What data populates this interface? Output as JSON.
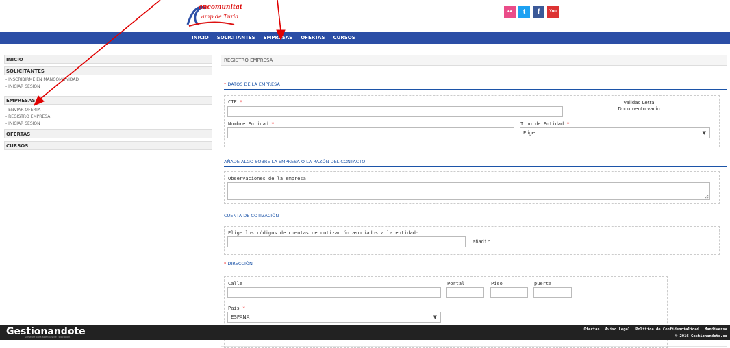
{
  "header": {
    "logo_line1": "ancomunitat",
    "logo_line2": "amp de Túria",
    "social_icons": [
      "flickr-icon",
      "twitter-icon",
      "facebook-icon",
      "youtube-icon"
    ],
    "social_glyphs": [
      "••",
      "t",
      "f",
      "You"
    ],
    "social_colors": [
      "#ea4c89",
      "#1da1f2",
      "#3b5998",
      "#d33"
    ]
  },
  "nav": {
    "items": [
      "INICIO",
      "SOLICITANTES",
      "EMPRESAS",
      "OFERTAS",
      "CURSOS"
    ],
    "bg": "#2b4ea6"
  },
  "sidebar": {
    "inicio": "INICIO",
    "solicitantes": "SOLICITANTES",
    "solicitantes_items": [
      "- INSCRIBIRME EN MANCOMUNIDAD",
      "- INICIAR SESIÓN"
    ],
    "empresas": "EMPRESAS",
    "empresas_items": [
      "- ENVIAR OFERTA",
      "- REGISTRO EMPRESA",
      "- INICIAR SESIÓN"
    ],
    "ofertas": "OFERTAS",
    "cursos": "CURSOS"
  },
  "main": {
    "title": "REGISTRO EMPRESA",
    "sec_datos": "DATOS DE LA EMPRESA",
    "cif_label": "CIF",
    "validac_line1": "Validac Letra",
    "validac_line2": "Documento vacío",
    "nombre_label": "Nombre Entidad",
    "tipo_label": "Tipo de Entidad",
    "tipo_value": "Elige",
    "sec_anade": "AÑADE ALGO SOBRE LA EMPRESA O LA RAZÓN DEL CONTACTO",
    "obs_label": "Observaciones de la empresa",
    "sec_cuenta": "CUENTA DE COTIZACIÓN",
    "cuenta_label": "Elige los códigos de cuentas de cotización asociados a la entidad:",
    "anadir": "añadir",
    "sec_direccion": "DIRECCIÓN",
    "calle_label": "Calle",
    "portal_label": "Portal",
    "piso_label": "Piso",
    "puerta_label": "puerta",
    "pais_label": "País",
    "pais_value": "ESPAÑA",
    "req": "*"
  },
  "footer": {
    "brand": "Gestionandote",
    "brand_sub": "Software para agencias de colocación",
    "links": [
      "Ofertas",
      "Aviso Legal",
      "Política de Confidencialidad",
      "Mandiversa"
    ],
    "copyright": "© 2016 Gestionandote.co"
  },
  "arrow_color": "#e00000"
}
